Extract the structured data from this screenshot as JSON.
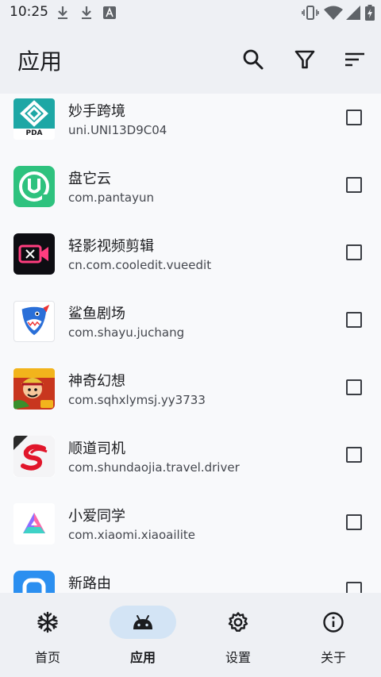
{
  "status_bar": {
    "time": "10:25",
    "left_icons": [
      "download-icon",
      "download-icon",
      "accessibility-a-icon"
    ],
    "right_icons": [
      "vibrate-icon",
      "wifi-icon",
      "signal-icon",
      "battery-charging-icon"
    ]
  },
  "app_bar": {
    "title": "应用",
    "actions": [
      "search-icon",
      "filter-icon",
      "sort-icon"
    ]
  },
  "apps": [
    {
      "name": "妙手跨境",
      "package": "uni.UNI13D9C04",
      "icon": "miaoshou-pda-icon",
      "icon_text": "PDA",
      "checked": false
    },
    {
      "name": "盘它云",
      "package": "com.pantayun",
      "icon": "pantayun-icon",
      "checked": false
    },
    {
      "name": "轻影视频剪辑",
      "package": "cn.com.cooledit.vueedit",
      "icon": "video-editor-icon",
      "checked": false
    },
    {
      "name": "鲨鱼剧场",
      "package": "com.shayu.juchang",
      "icon": "shark-icon",
      "checked": false
    },
    {
      "name": "神奇幻想",
      "package": "com.sqhxlymsj.yy3733",
      "icon": "game-character-icon",
      "checked": false
    },
    {
      "name": "顺道司机",
      "package": "com.shundaojia.travel.driver",
      "icon": "shundao-s-icon",
      "checked": false
    },
    {
      "name": "小爱同学",
      "package": "com.xiaomi.xiaoailite",
      "icon": "xiaoai-icon",
      "checked": false
    },
    {
      "name": "新路由",
      "package": "",
      "icon": "router-icon",
      "checked": false
    }
  ],
  "bottom_nav": [
    {
      "label": "首页",
      "icon": "snowflake-icon",
      "active": false
    },
    {
      "label": "应用",
      "icon": "android-icon",
      "active": true
    },
    {
      "label": "设置",
      "icon": "gear-icon",
      "active": false
    },
    {
      "label": "关于",
      "icon": "info-icon",
      "active": false
    }
  ],
  "colors": {
    "surface": "#eef0f4",
    "background": "#f8f9fb",
    "active_pill": "#d3e4f5",
    "pantayun_green": "#2ec27e",
    "router_blue": "#2b8ff0"
  }
}
